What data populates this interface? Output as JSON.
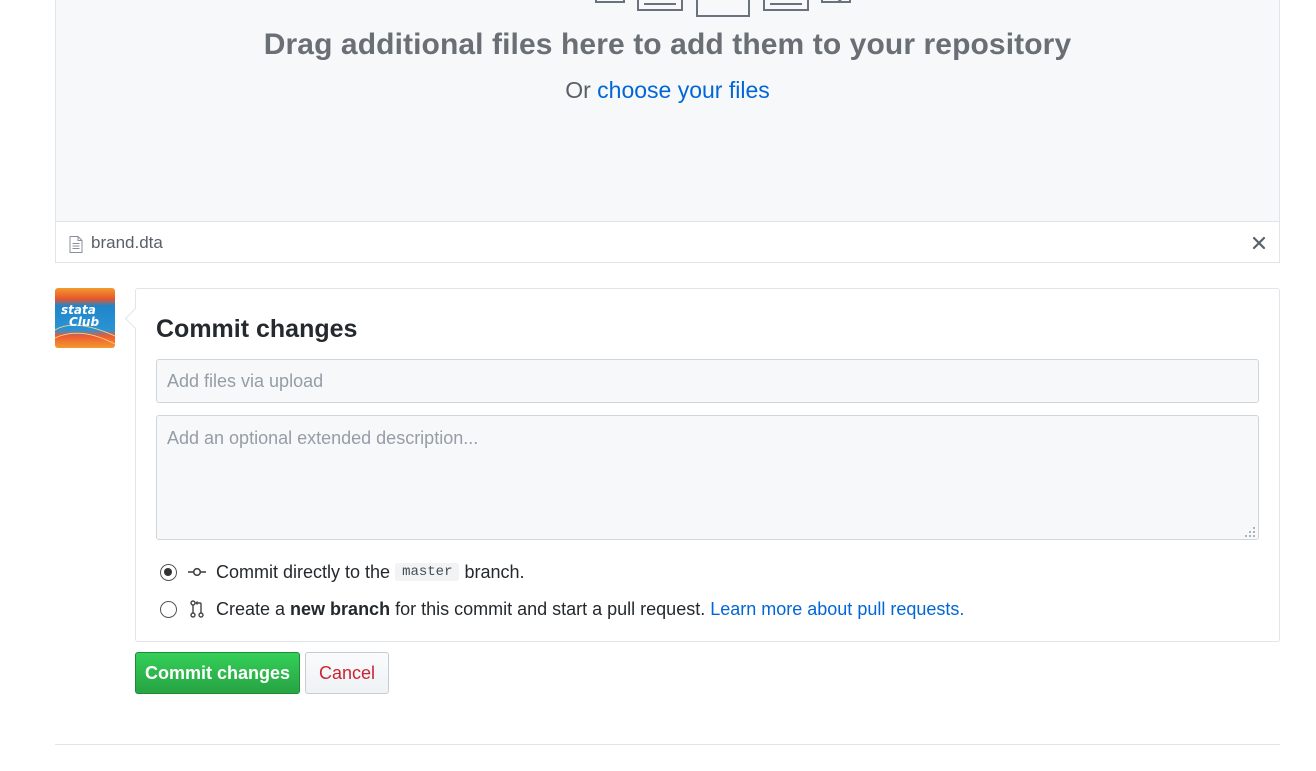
{
  "dropzone": {
    "title": "Drag additional files here to add them to your repository",
    "or_text": "Or",
    "choose_link": "choose your files"
  },
  "files": [
    {
      "name": "brand.dta"
    }
  ],
  "commit": {
    "title": "Commit changes",
    "summary_placeholder": "Add files via upload",
    "description_placeholder": "Add an optional extended description...",
    "option_direct": {
      "prefix": "Commit directly to the",
      "branch": "master",
      "suffix": "branch.",
      "selected": true
    },
    "option_new_branch": {
      "prefix": "Create a",
      "bold": "new branch",
      "suffix": "for this commit and start a pull request.",
      "link": "Learn more about pull requests.",
      "selected": false
    }
  },
  "buttons": {
    "commit_label": "Commit changes",
    "cancel_label": "Cancel"
  },
  "colors": {
    "primary_green": "#28a745",
    "link_blue": "#0366d6",
    "cancel_red": "#cb2431"
  }
}
